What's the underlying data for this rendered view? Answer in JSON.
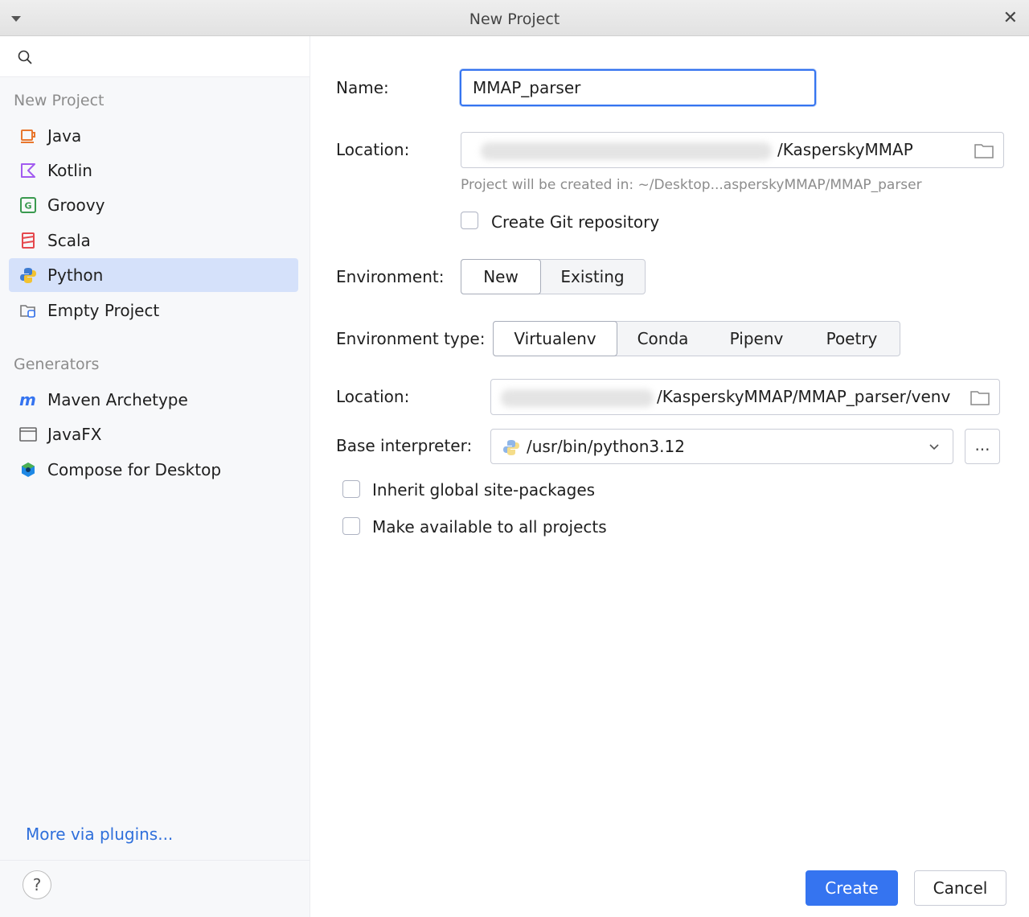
{
  "window": {
    "title": "New Project"
  },
  "sidebar": {
    "section_new": "New Project",
    "items": [
      {
        "label": "Java",
        "icon": "java-cup-icon"
      },
      {
        "label": "Kotlin",
        "icon": "kotlin-icon"
      },
      {
        "label": "Groovy",
        "icon": "groovy-icon"
      },
      {
        "label": "Scala",
        "icon": "scala-icon"
      },
      {
        "label": "Python",
        "icon": "python-icon",
        "selected": true
      },
      {
        "label": "Empty Project",
        "icon": "empty-project-icon"
      }
    ],
    "section_generators": "Generators",
    "generators": [
      {
        "label": "Maven Archetype",
        "icon": "maven-icon"
      },
      {
        "label": "JavaFX",
        "icon": "javafx-window-icon"
      },
      {
        "label": "Compose for Desktop",
        "icon": "compose-icon"
      }
    ],
    "more_plugins": "More via plugins...",
    "help": "?"
  },
  "form": {
    "name_label": "Name:",
    "name_value": "MMAP_parser",
    "location_label": "Location:",
    "location_value": "/KasperskyMMAP",
    "hint": "Project will be created in: ~/Desktop...asperskyMMAP/MMAP_parser",
    "git_label": "Create Git repository",
    "environment_label": "Environment:",
    "environment_options": [
      "New",
      "Existing"
    ],
    "environment_selected": "New",
    "env_type_label": "Environment type:",
    "env_type_options": [
      "Virtualenv",
      "Conda",
      "Pipenv",
      "Poetry"
    ],
    "env_type_selected": "Virtualenv",
    "venv_location_label": "Location:",
    "venv_location_value": "/KasperskyMMAP/MMAP_parser/venv",
    "base_interp_label": "Base interpreter:",
    "base_interp_value": "/usr/bin/python3.12",
    "more_button": "...",
    "inherit_label": "Inherit global site-packages",
    "make_available_label": "Make available to all projects"
  },
  "buttons": {
    "create": "Create",
    "cancel": "Cancel"
  },
  "colors": {
    "accent": "#3574f0",
    "selection": "#d5e1fa",
    "sidebar_bg": "#f7f8fa"
  }
}
